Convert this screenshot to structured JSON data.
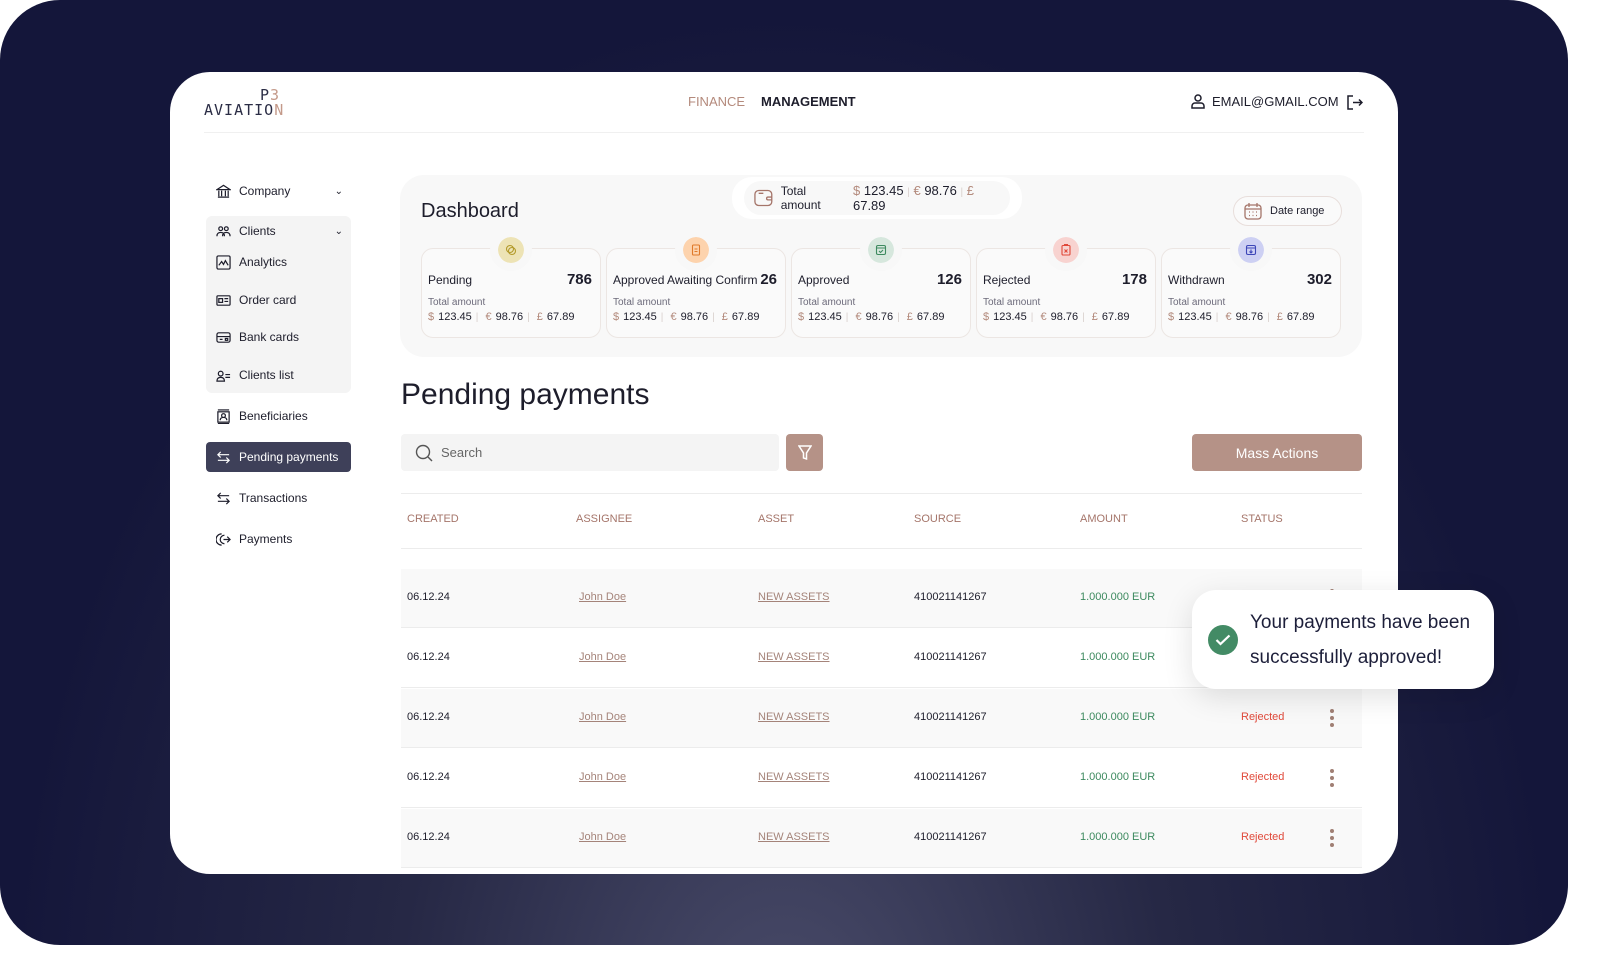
{
  "logo": {
    "line1": "P3",
    "line2": "AVIATION"
  },
  "header": {
    "nav": [
      {
        "label": "FINANCE",
        "active": true
      },
      {
        "label": "MANAGEMENT",
        "active": false
      }
    ],
    "email": "EMAIL@GMAIL.COM"
  },
  "sidebar": {
    "items": [
      {
        "label": "Company",
        "icon": "bank-icon"
      },
      {
        "label": "Clients",
        "icon": "users-icon"
      },
      {
        "label": "Analytics",
        "icon": "chart-icon"
      },
      {
        "label": "Order card",
        "icon": "id-card-icon"
      },
      {
        "label": "Bank cards",
        "icon": "credit-card-icon"
      },
      {
        "label": "Clients list",
        "icon": "user-list-icon"
      },
      {
        "label": "Beneficiaries",
        "icon": "beneficiary-icon"
      },
      {
        "label": "Pending payments",
        "icon": "arrows-swap-icon",
        "active": true
      },
      {
        "label": "Transactions",
        "icon": "arrows-swap-icon"
      },
      {
        "label": "Payments",
        "icon": "payments-icon"
      }
    ]
  },
  "dashboard": {
    "title": "Dashboard",
    "total_label": "Total amount",
    "total": {
      "usd": "123.45",
      "eur": "98.76",
      "gbp": "67.89"
    },
    "date_range": "Date range",
    "currency_symbols": {
      "usd": "$",
      "eur": "€",
      "gbp": "£"
    },
    "cards": [
      {
        "label": "Pending",
        "count": "786",
        "color": "#ede3b5",
        "icolor": "#b39a2a",
        "total_label": "Total amount",
        "usd": "123.45",
        "eur": "98.76",
        "gbp": "67.89"
      },
      {
        "label": "Approved Awaiting Confirm",
        "count": "26",
        "color": "#fdd3ad",
        "icolor": "#e07a2a",
        "total_label": "Total amount",
        "usd": "123.45",
        "eur": "98.76",
        "gbp": "67.89"
      },
      {
        "label": "Approved",
        "count": "126",
        "color": "#d6e7dd",
        "icolor": "#3d8a5f",
        "total_label": "Total amount",
        "usd": "123.45",
        "eur": "98.76",
        "gbp": "67.89"
      },
      {
        "label": "Rejected",
        "count": "178",
        "color": "#f8d3d0",
        "icolor": "#e0493a",
        "total_label": "Total amount",
        "usd": "123.45",
        "eur": "98.76",
        "gbp": "67.89"
      },
      {
        "label": "Withdrawn",
        "count": "302",
        "color": "#cdd0f3",
        "icolor": "#3d46b8",
        "total_label": "Total amount",
        "usd": "123.45",
        "eur": "98.76",
        "gbp": "67.89"
      }
    ]
  },
  "page": {
    "title": "Pending payments",
    "search_placeholder": "Search",
    "mass_actions": "Mass Actions"
  },
  "table": {
    "headers": [
      "CREATED",
      "ASSIGNEE",
      "ASSET",
      "SOURCE",
      "AMOUNT",
      "STATUS"
    ],
    "rows": [
      {
        "created": "06.12.24",
        "assignee": "John Doe",
        "asset": "NEW ASSETS",
        "source": "410021141267",
        "amount": "1.000.000 EUR",
        "status": ""
      },
      {
        "created": "06.12.24",
        "assignee": "John Doe",
        "asset": "NEW ASSETS",
        "source": "410021141267",
        "amount": "1.000.000 EUR",
        "status": ""
      },
      {
        "created": "06.12.24",
        "assignee": "John Doe",
        "asset": "NEW ASSETS",
        "source": "410021141267",
        "amount": "1.000.000 EUR",
        "status": "Rejected"
      },
      {
        "created": "06.12.24",
        "assignee": "John Doe",
        "asset": "NEW ASSETS",
        "source": "410021141267",
        "amount": "1.000.000 EUR",
        "status": "Rejected"
      },
      {
        "created": "06.12.24",
        "assignee": "John Doe",
        "asset": "NEW ASSETS",
        "source": "410021141267",
        "amount": "1.000.000 EUR",
        "status": "Rejected"
      }
    ]
  },
  "toast": {
    "message": "Your payments have been successfully approved!",
    "icon": "check-circle-icon"
  },
  "colors": {
    "accent": "#b59287",
    "sidebar_active": "#3e4059",
    "success": "#438b65",
    "danger": "#e0493a"
  }
}
